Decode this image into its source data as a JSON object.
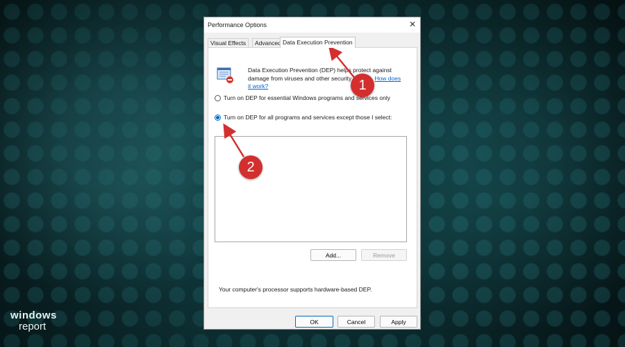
{
  "window": {
    "title": "Performance Options",
    "close_glyph": "✕"
  },
  "tabs": [
    {
      "label": "Visual Effects",
      "active": false
    },
    {
      "label": "Advanced",
      "active": false
    },
    {
      "label": "Data Execution Prevention",
      "active": true
    }
  ],
  "panel": {
    "icon": "dep-shield-icon",
    "description": "Data Execution Prevention (DEP) helps protect against damage from viruses and other security threats.",
    "link_text": "How does it work?",
    "options": [
      {
        "label": "Turn on DEP for essential Windows programs and services only",
        "selected": false
      },
      {
        "label": "Turn on DEP for all programs and services except those I select:",
        "selected": true
      }
    ],
    "add_label": "Add...",
    "remove_label": "Remove",
    "hardware_note": "Your computer's processor supports hardware-based DEP."
  },
  "footer": {
    "ok_label": "OK",
    "cancel_label": "Cancel",
    "apply_label": "Apply"
  },
  "annotations": {
    "marker_1": "1",
    "marker_2": "2",
    "color": "#d32f2f"
  },
  "brand": {
    "line1": "windows",
    "line2": "report"
  }
}
